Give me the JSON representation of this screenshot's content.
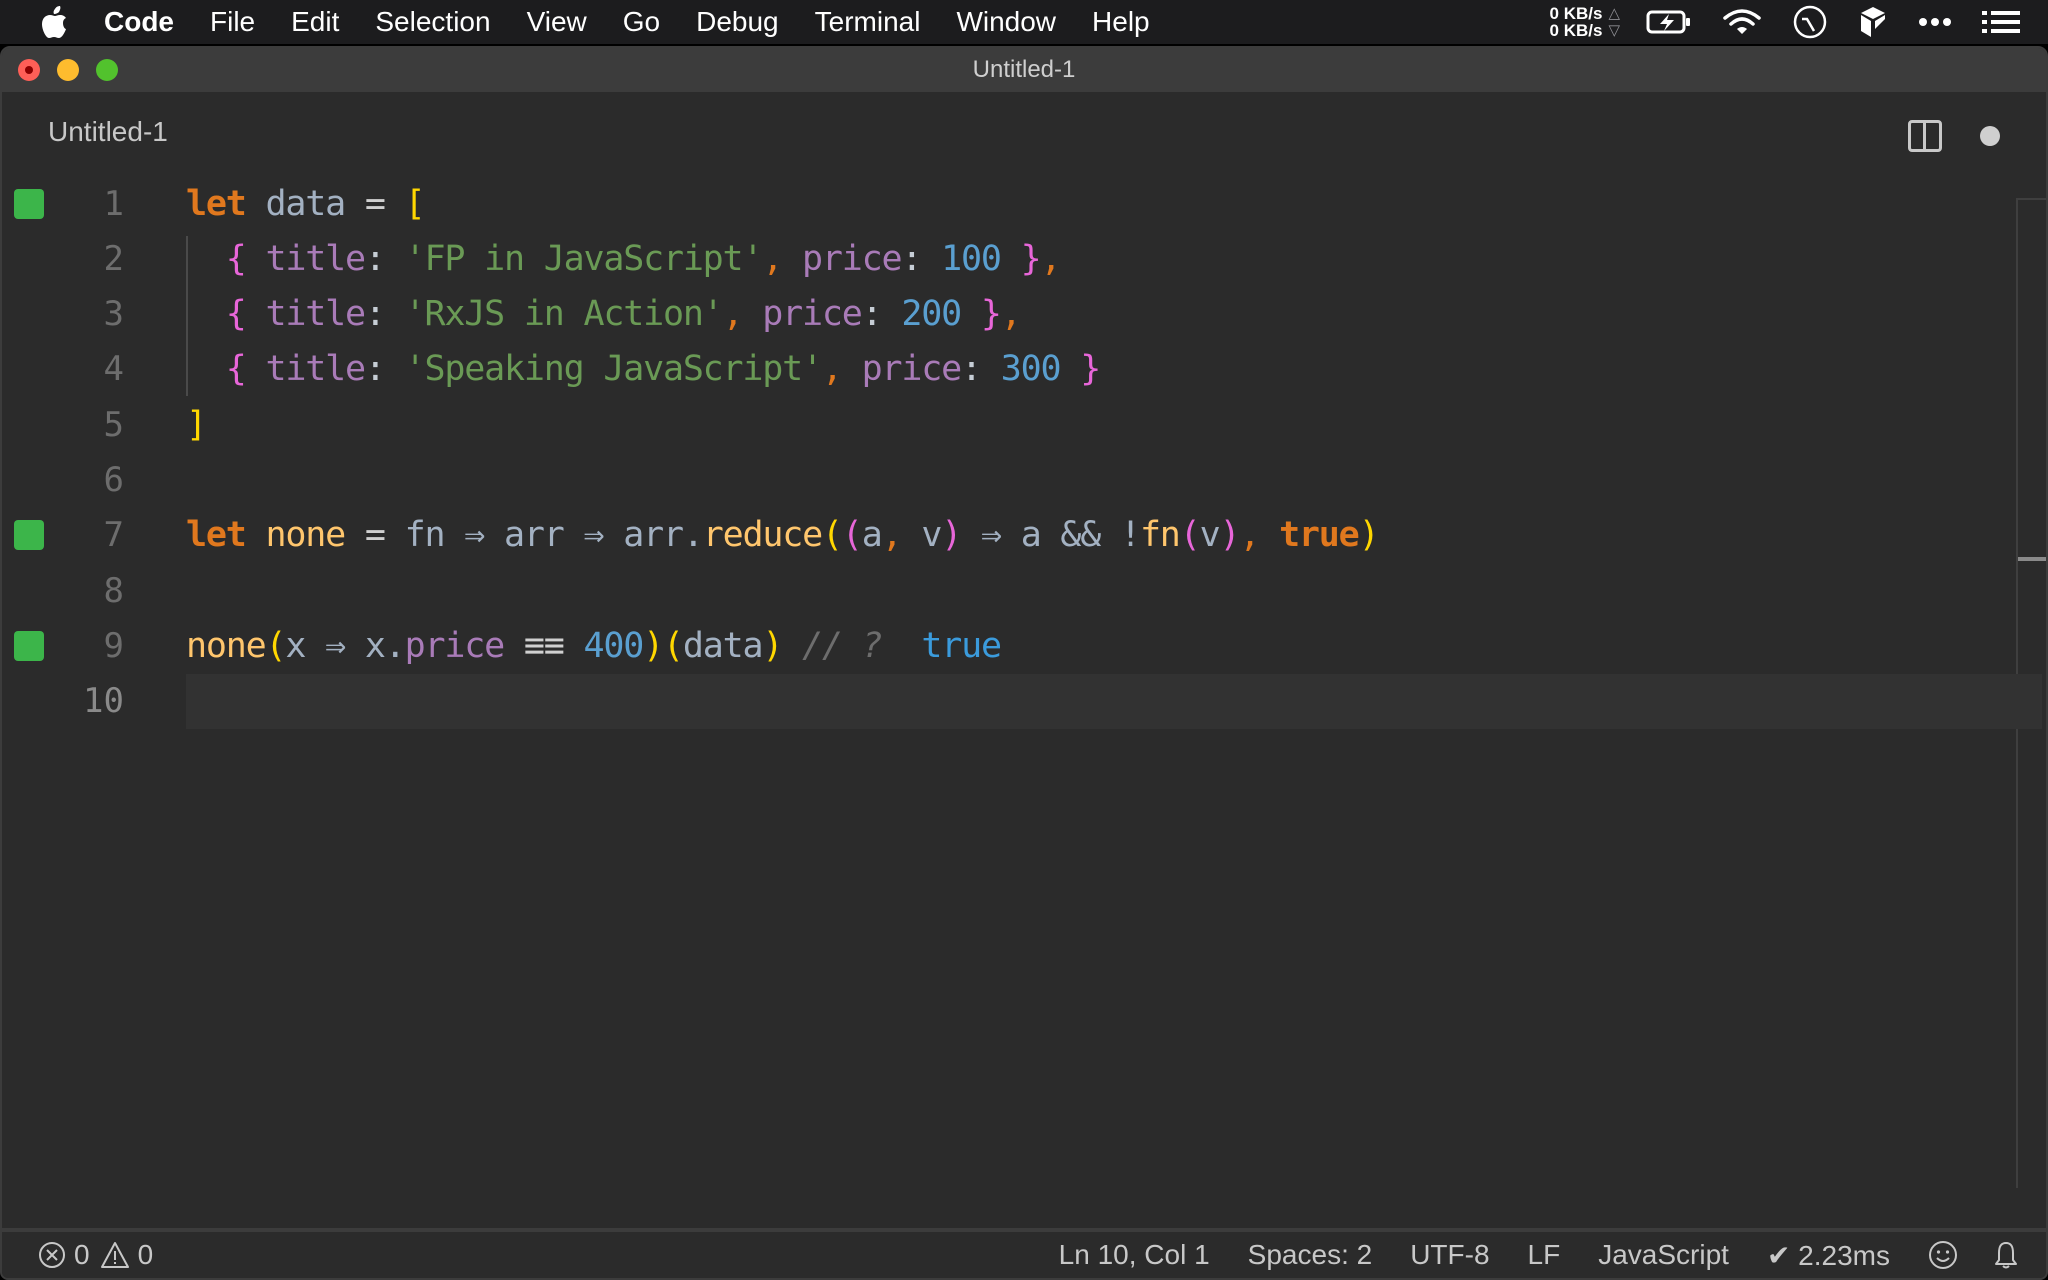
{
  "menubar": {
    "app_name": "Code",
    "items": [
      "File",
      "Edit",
      "Selection",
      "View",
      "Go",
      "Debug",
      "Terminal",
      "Window",
      "Help"
    ],
    "net_up": "0 KB/s",
    "net_down": "0 KB/s",
    "icons": [
      "battery-charging-icon",
      "wifi-icon",
      "clock-icon",
      "cube-icon",
      "more-icon",
      "list-icon"
    ]
  },
  "window": {
    "title": "Untitled-1"
  },
  "tab": {
    "label": "Untitled-1",
    "dirty": true
  },
  "editor": {
    "current_line": 10,
    "lines": [
      {
        "number": "1",
        "marker": true,
        "tokens": [
          {
            "t": "let",
            "c": "kw"
          },
          {
            "t": " data ",
            "c": "var"
          },
          {
            "t": "=",
            "c": "op"
          },
          {
            "t": " ",
            "c": "var"
          },
          {
            "t": "[",
            "c": "brk1"
          }
        ]
      },
      {
        "number": "2",
        "marker": false,
        "tokens": [
          {
            "t": "  ",
            "c": "var"
          },
          {
            "t": "{",
            "c": "brk2"
          },
          {
            "t": " title",
            "c": "prop"
          },
          {
            "t": ": ",
            "c": "colon"
          },
          {
            "t": "'FP in JavaScript'",
            "c": "str"
          },
          {
            "t": ",",
            "c": "punc"
          },
          {
            "t": " price",
            "c": "prop"
          },
          {
            "t": ": ",
            "c": "colon"
          },
          {
            "t": "100",
            "c": "num"
          },
          {
            "t": " ",
            "c": "var"
          },
          {
            "t": "}",
            "c": "brk2"
          },
          {
            "t": ",",
            "c": "punc"
          }
        ]
      },
      {
        "number": "3",
        "marker": false,
        "tokens": [
          {
            "t": "  ",
            "c": "var"
          },
          {
            "t": "{",
            "c": "brk2"
          },
          {
            "t": " title",
            "c": "prop"
          },
          {
            "t": ": ",
            "c": "colon"
          },
          {
            "t": "'RxJS in Action'",
            "c": "str"
          },
          {
            "t": ",",
            "c": "punc"
          },
          {
            "t": " price",
            "c": "prop"
          },
          {
            "t": ": ",
            "c": "colon"
          },
          {
            "t": "200",
            "c": "num"
          },
          {
            "t": " ",
            "c": "var"
          },
          {
            "t": "}",
            "c": "brk2"
          },
          {
            "t": ",",
            "c": "punc"
          }
        ]
      },
      {
        "number": "4",
        "marker": false,
        "tokens": [
          {
            "t": "  ",
            "c": "var"
          },
          {
            "t": "{",
            "c": "brk2"
          },
          {
            "t": " title",
            "c": "prop"
          },
          {
            "t": ": ",
            "c": "colon"
          },
          {
            "t": "'Speaking JavaScript'",
            "c": "str"
          },
          {
            "t": ",",
            "c": "punc"
          },
          {
            "t": " price",
            "c": "prop"
          },
          {
            "t": ": ",
            "c": "colon"
          },
          {
            "t": "300",
            "c": "num"
          },
          {
            "t": " ",
            "c": "var"
          },
          {
            "t": "}",
            "c": "brk2"
          }
        ]
      },
      {
        "number": "5",
        "marker": false,
        "tokens": [
          {
            "t": "]",
            "c": "brk1"
          }
        ]
      },
      {
        "number": "6",
        "marker": false,
        "tokens": []
      },
      {
        "number": "7",
        "marker": true,
        "tokens": [
          {
            "t": "let",
            "c": "kw"
          },
          {
            "t": " ",
            "c": "var"
          },
          {
            "t": "none",
            "c": "fnname"
          },
          {
            "t": " = ",
            "c": "op"
          },
          {
            "t": "fn ",
            "c": "var"
          },
          {
            "t": "⇒",
            "c": "var"
          },
          {
            "t": " arr ",
            "c": "var"
          },
          {
            "t": "⇒",
            "c": "var"
          },
          {
            "t": " arr.",
            "c": "var"
          },
          {
            "t": "reduce",
            "c": "fnname"
          },
          {
            "t": "(",
            "c": "brk1"
          },
          {
            "t": "(",
            "c": "brk2"
          },
          {
            "t": "a",
            "c": "var"
          },
          {
            "t": ",",
            "c": "punc"
          },
          {
            "t": " v",
            "c": "var"
          },
          {
            "t": ")",
            "c": "brk2"
          },
          {
            "t": " ⇒ a && !",
            "c": "var"
          },
          {
            "t": "fn",
            "c": "fnname"
          },
          {
            "t": "(",
            "c": "brk2"
          },
          {
            "t": "v",
            "c": "var"
          },
          {
            "t": ")",
            "c": "brk2"
          },
          {
            "t": ",",
            "c": "punc"
          },
          {
            "t": " ",
            "c": "var"
          },
          {
            "t": "true",
            "c": "kw"
          },
          {
            "t": ")",
            "c": "brk1"
          }
        ]
      },
      {
        "number": "8",
        "marker": false,
        "tokens": []
      },
      {
        "number": "9",
        "marker": true,
        "tokens": [
          {
            "t": "none",
            "c": "fnname"
          },
          {
            "t": "(",
            "c": "brk1"
          },
          {
            "t": "x ⇒ x.",
            "c": "var"
          },
          {
            "t": "price",
            "c": "prop"
          },
          {
            "t": " ≡≡ ",
            "c": "op"
          },
          {
            "t": "400",
            "c": "num"
          },
          {
            "t": ")",
            "c": "brk1"
          },
          {
            "t": "(",
            "c": "brk1"
          },
          {
            "t": "data",
            "c": "var"
          },
          {
            "t": ")",
            "c": "brk1"
          },
          {
            "t": " // ?  ",
            "c": "comment"
          },
          {
            "t": "true",
            "c": "result"
          }
        ]
      },
      {
        "number": "10",
        "marker": false,
        "tokens": []
      }
    ]
  },
  "statusbar": {
    "errors": "0",
    "warnings": "0",
    "position": "Ln 10, Col 1",
    "indent": "Spaces: 2",
    "encoding": "UTF-8",
    "eol": "LF",
    "language": "JavaScript",
    "timing": "✔ 2.23ms"
  }
}
